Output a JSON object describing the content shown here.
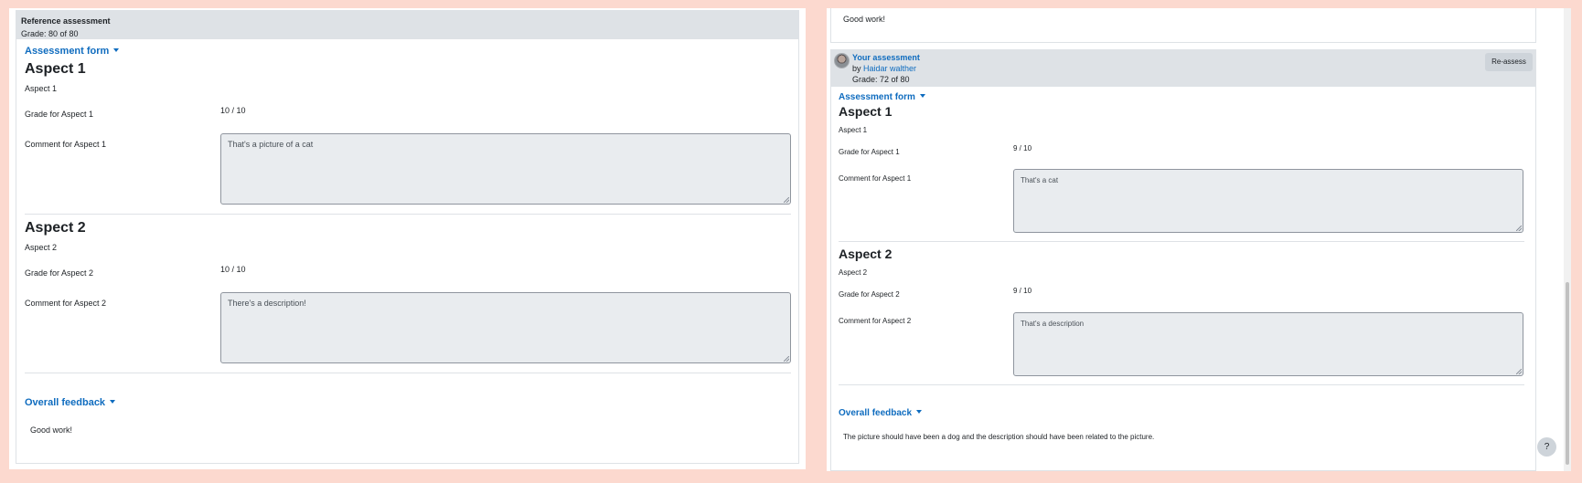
{
  "left": {
    "header_title": "Reference assessment",
    "header_grade": "Grade: 80 of 80",
    "form_link": "Assessment form",
    "aspects": [
      {
        "heading": "Aspect 1",
        "description": "Aspect 1",
        "grade_label": "Grade for Aspect 1",
        "grade_value": "10 / 10",
        "comment_label": "Comment for Aspect 1",
        "comment": "That's a picture of a cat"
      },
      {
        "heading": "Aspect 2",
        "description": "Aspect 2",
        "grade_label": "Grade for Aspect 2",
        "grade_value": "10 / 10",
        "comment_label": "Comment for Aspect 2",
        "comment": "There's a description!"
      }
    ],
    "feedback_link": "Overall feedback",
    "feedback_text": "Good work!"
  },
  "right": {
    "top_text": "Good work!",
    "header_title": "Your assessment",
    "header_by": "by",
    "header_user": "Haidar walther",
    "header_grade": "Grade: 72 of 80",
    "reassess_button": "Re-assess",
    "form_link": "Assessment form",
    "aspects": [
      {
        "heading": "Aspect 1",
        "description": "Aspect 1",
        "grade_label": "Grade for Aspect 1",
        "grade_value": "9 / 10",
        "comment_label": "Comment for Aspect 1",
        "comment": "That's a cat"
      },
      {
        "heading": "Aspect 2",
        "description": "Aspect 2",
        "grade_label": "Grade for Aspect 2",
        "grade_value": "9 / 10",
        "comment_label": "Comment for Aspect 2",
        "comment": "That's a description"
      }
    ],
    "feedback_link": "Overall feedback",
    "feedback_text": "The picture should have been a dog and the description should have been related to the picture.",
    "help_button": "?"
  },
  "colors": {
    "background": "#fcd9cf",
    "link": "#0f6cbf",
    "header_bg": "#dee2e6",
    "textarea_bg": "#e9ecef"
  },
  "icons": [
    "caret-down-icon",
    "avatar",
    "resize-handle-icon",
    "help-icon"
  ]
}
